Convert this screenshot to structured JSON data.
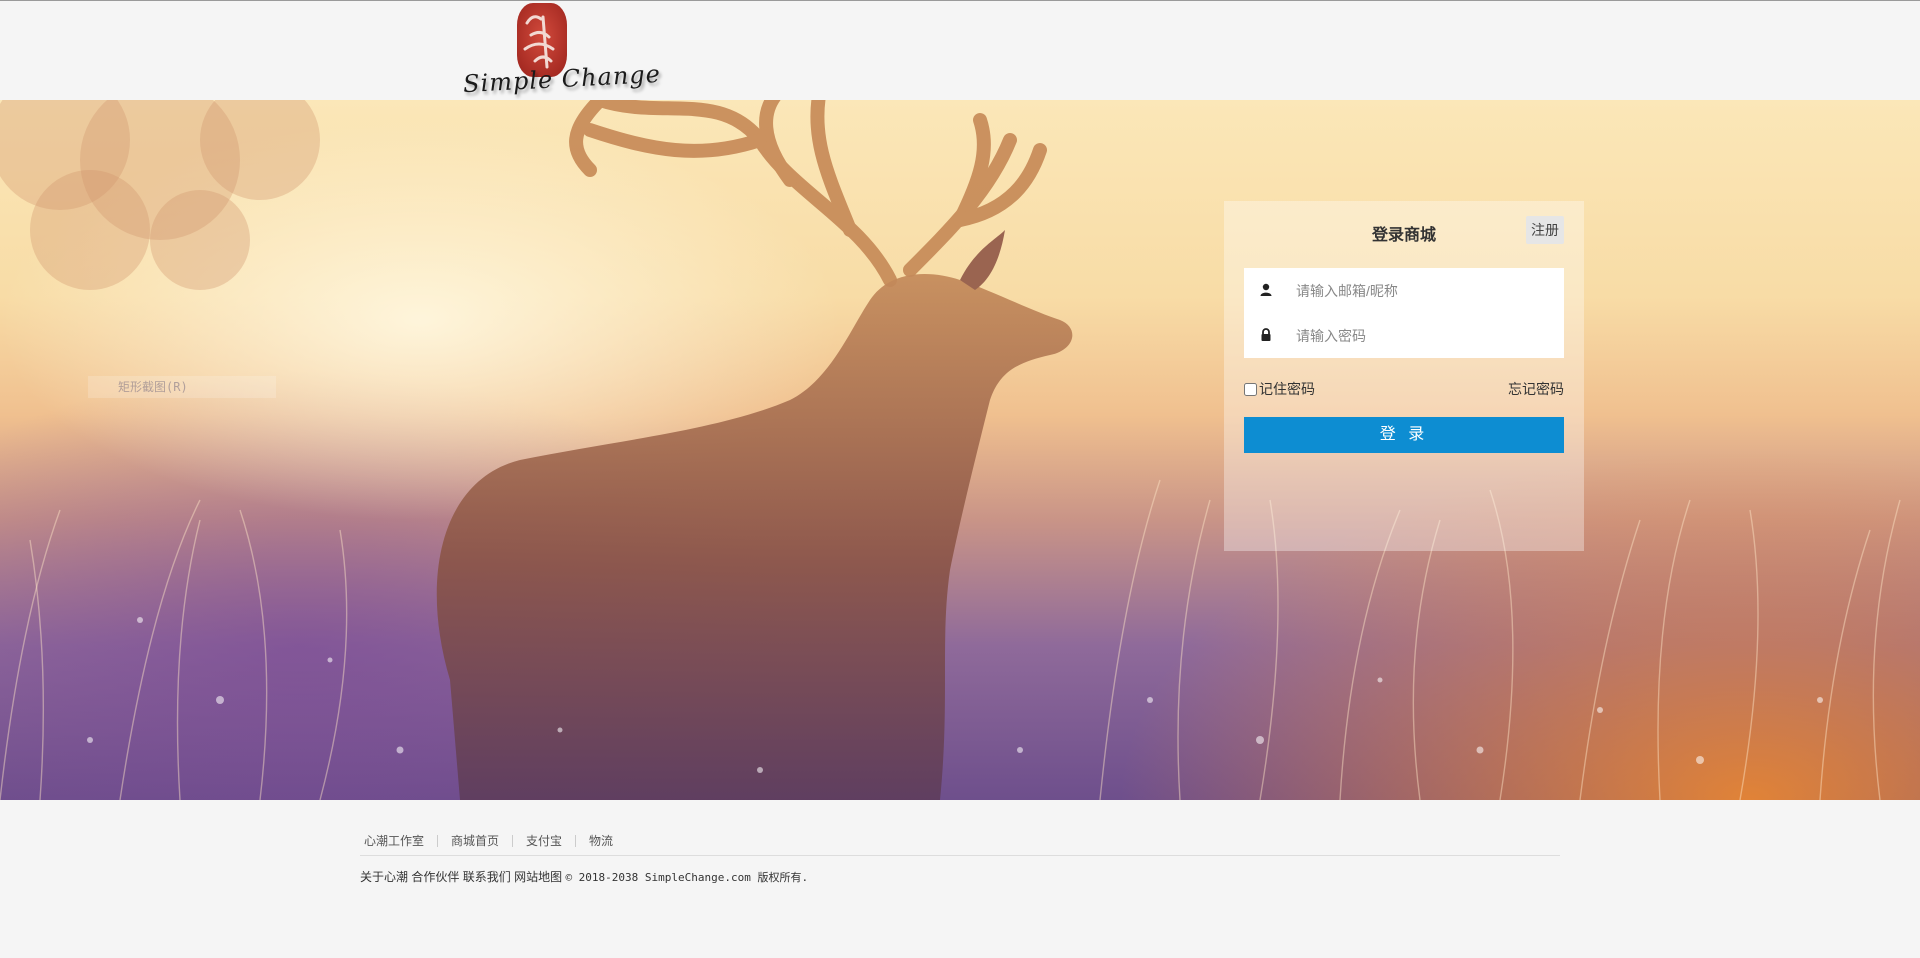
{
  "header": {
    "logo_seal_text": "心潮",
    "logo_script_text": "Simple Change"
  },
  "banner": {
    "ghost_tip_text": "矩形截图(R)"
  },
  "login": {
    "title": "登录商城",
    "register_label": "注册",
    "username_placeholder": "请输入邮箱/昵称",
    "password_placeholder": "请输入密码",
    "remember_label": "记住密码",
    "forgot_label": "忘记密码",
    "submit_label": "登 录",
    "accent_color": "#0d8dd2"
  },
  "footer": {
    "links": [
      "心潮工作室",
      "商城首页",
      "支付宝",
      "物流"
    ],
    "bottom_links": [
      "关于心潮",
      "合作伙伴",
      "联系我们",
      "网站地图"
    ],
    "copyright": "© 2018-2038 SimpleChange.com 版权所有."
  }
}
